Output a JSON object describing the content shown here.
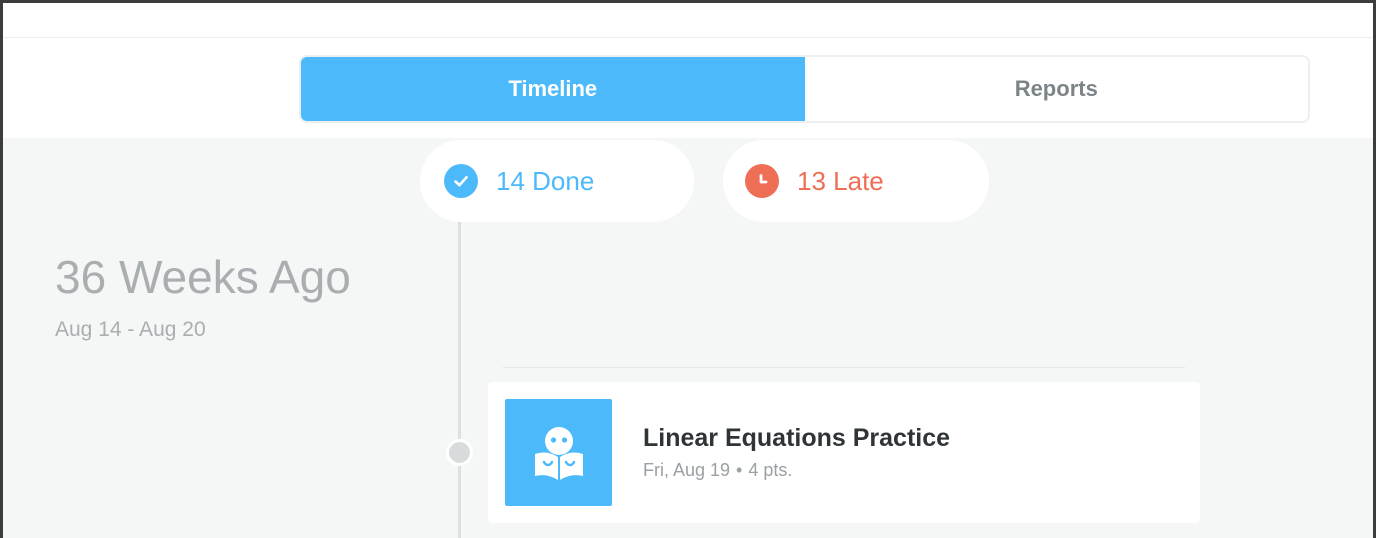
{
  "tabs": {
    "timeline": "Timeline",
    "reports": "Reports",
    "active": "timeline"
  },
  "summary": {
    "done_label": "14 Done",
    "late_label": "13 Late",
    "done_icon": "check-circle-icon",
    "late_icon": "clock-icon"
  },
  "week": {
    "title": "36 Weeks Ago",
    "range": "Aug 14 - Aug 20"
  },
  "assignments": [
    {
      "title": "Linear Equations Practice",
      "date": "Fri, Aug 19",
      "separator": "•",
      "points": "4 pts.",
      "icon": "student-reading-icon"
    }
  ],
  "colors": {
    "accent": "#4cb9fb",
    "late": "#ee6e56",
    "muted_text": "#a9aeb0",
    "background": "#f5f7f7"
  }
}
